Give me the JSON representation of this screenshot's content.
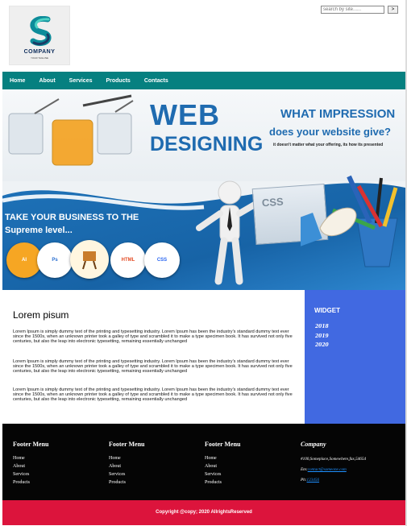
{
  "header": {
    "logo_name": "COMPANY",
    "logo_tagline": "YOUR TAGLINE",
    "search_placeholder": "search by site......",
    "search_button": ">"
  },
  "nav": [
    "Home",
    "About",
    "Services",
    "Products",
    "Contacts"
  ],
  "banner": {
    "title_1": "WEB",
    "title_2": "DESIGNING",
    "headline_1": "WHAT IMPRESSION",
    "headline_2": "does your website give?",
    "subline": "it doesn't matter what your offering, its how its presented",
    "take_1": "TAKE YOUR BUSINESS TO THE",
    "take_2": "Supreme level...",
    "icons": [
      "AI",
      "Ps",
      "",
      "HTML",
      "CSS"
    ],
    "board_label": "CSS"
  },
  "main": {
    "heading": "Lorem pisum",
    "paragraphs": [
      "Lorem Ipsum is simply dummy text of the printing and typesetting industry. Lorem Ipsum has been the industry's standard dummy text ever since the 1500s, when an unknown printer took a galley of type and scrambled it to make a type specimen book. It has survived not only five centuries, but also the leap into electronic typesetting, remaining essentially unchanged",
      "Lorem Ipsum is simply dummy text of the printing and typesetting industry. Lorem Ipsum has been the industry's standard dummy text ever since the 1500s, when an unknown printer took a galley of type and scrambled it to make a type specimen book. It has survived not only five centuries, but also the leap into electronic typesetting, remaining essentially unchanged",
      "Lorem Ipsum is simply dummy text of the printing and typesetting industry. Lorem Ipsum has been the industry's standard dummy text ever since the 1500s, when an unknown printer took a galley of type and scrambled it to make a type specimen book. It has survived not only five centuries, but also the leap into electronic typesetting, remaining essentially unchanged"
    ]
  },
  "widget": {
    "title": "WIDGET",
    "years": [
      "2018",
      "2019",
      "2020"
    ]
  },
  "footer": {
    "menus": [
      {
        "title": "Footer Menu",
        "items": [
          "Home",
          "About",
          "Services",
          "Products"
        ]
      },
      {
        "title": "Footer Menu",
        "items": [
          "Home",
          "About",
          "Services",
          "Products"
        ]
      },
      {
        "title": "Footer Menu",
        "items": [
          "Home",
          "About",
          "Services",
          "Products"
        ]
      }
    ],
    "company": {
      "title": "Company",
      "address": "#100,Someplace,Somewhere,fax,54654",
      "email_label": "Em:",
      "email": "contact@someone.com",
      "phone_label": "Ph:",
      "phone": "123456"
    }
  },
  "copyright": "Copyright @copy; 2020 AllrightsReserved"
}
